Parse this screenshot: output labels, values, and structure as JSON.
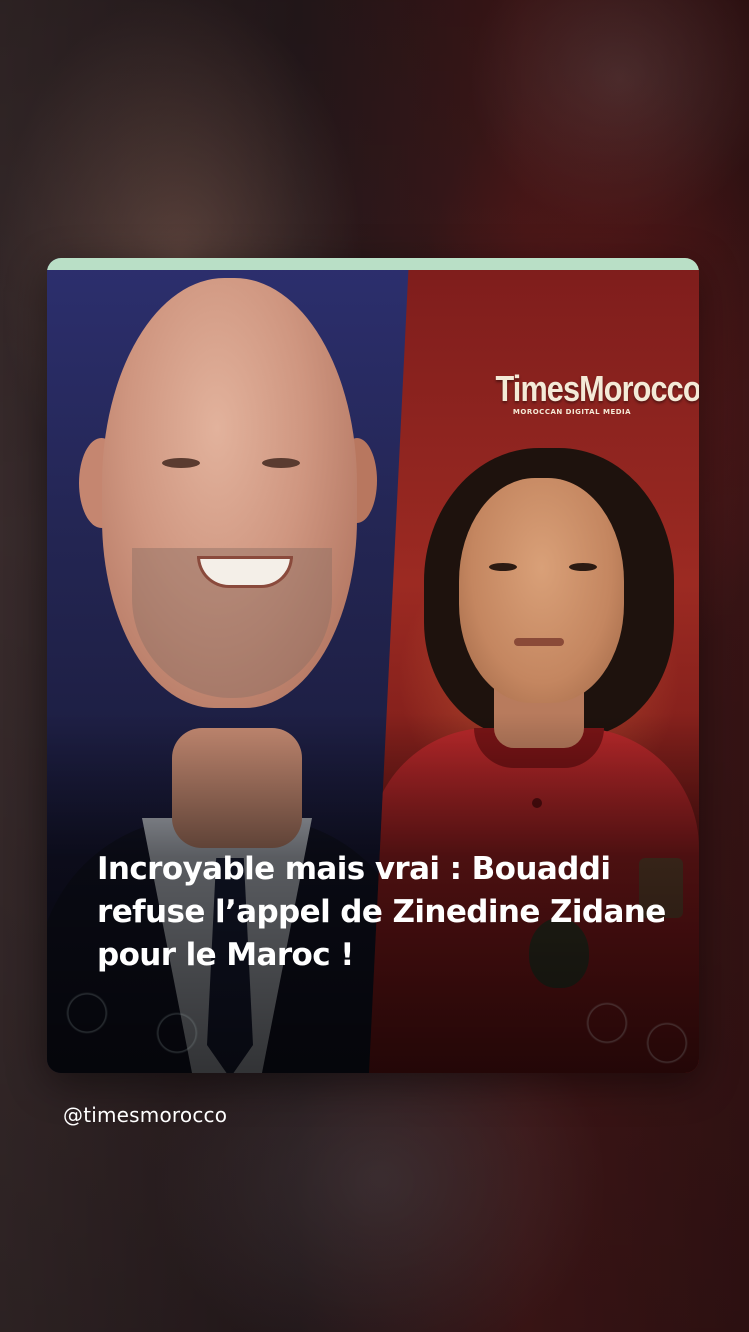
{
  "post": {
    "brand": {
      "name": "TimesMorocco",
      "tagline": "MOROCCAN DIGITAL MEDIA"
    },
    "headline": "Incroyable mais vrai : Bouaddi refuse l’appel de Zinedine Zidane pour le Maroc !",
    "handle": "@timesmorocco"
  },
  "colors": {
    "accent_bar": "#b9dfc6",
    "left_panel": "#232552",
    "right_panel": "#9c2a22",
    "headline_text": "#ffffff"
  },
  "icons": [
    "zinedine-zidane-photo",
    "bouaddi-photo",
    "timesmorocco-logo"
  ]
}
